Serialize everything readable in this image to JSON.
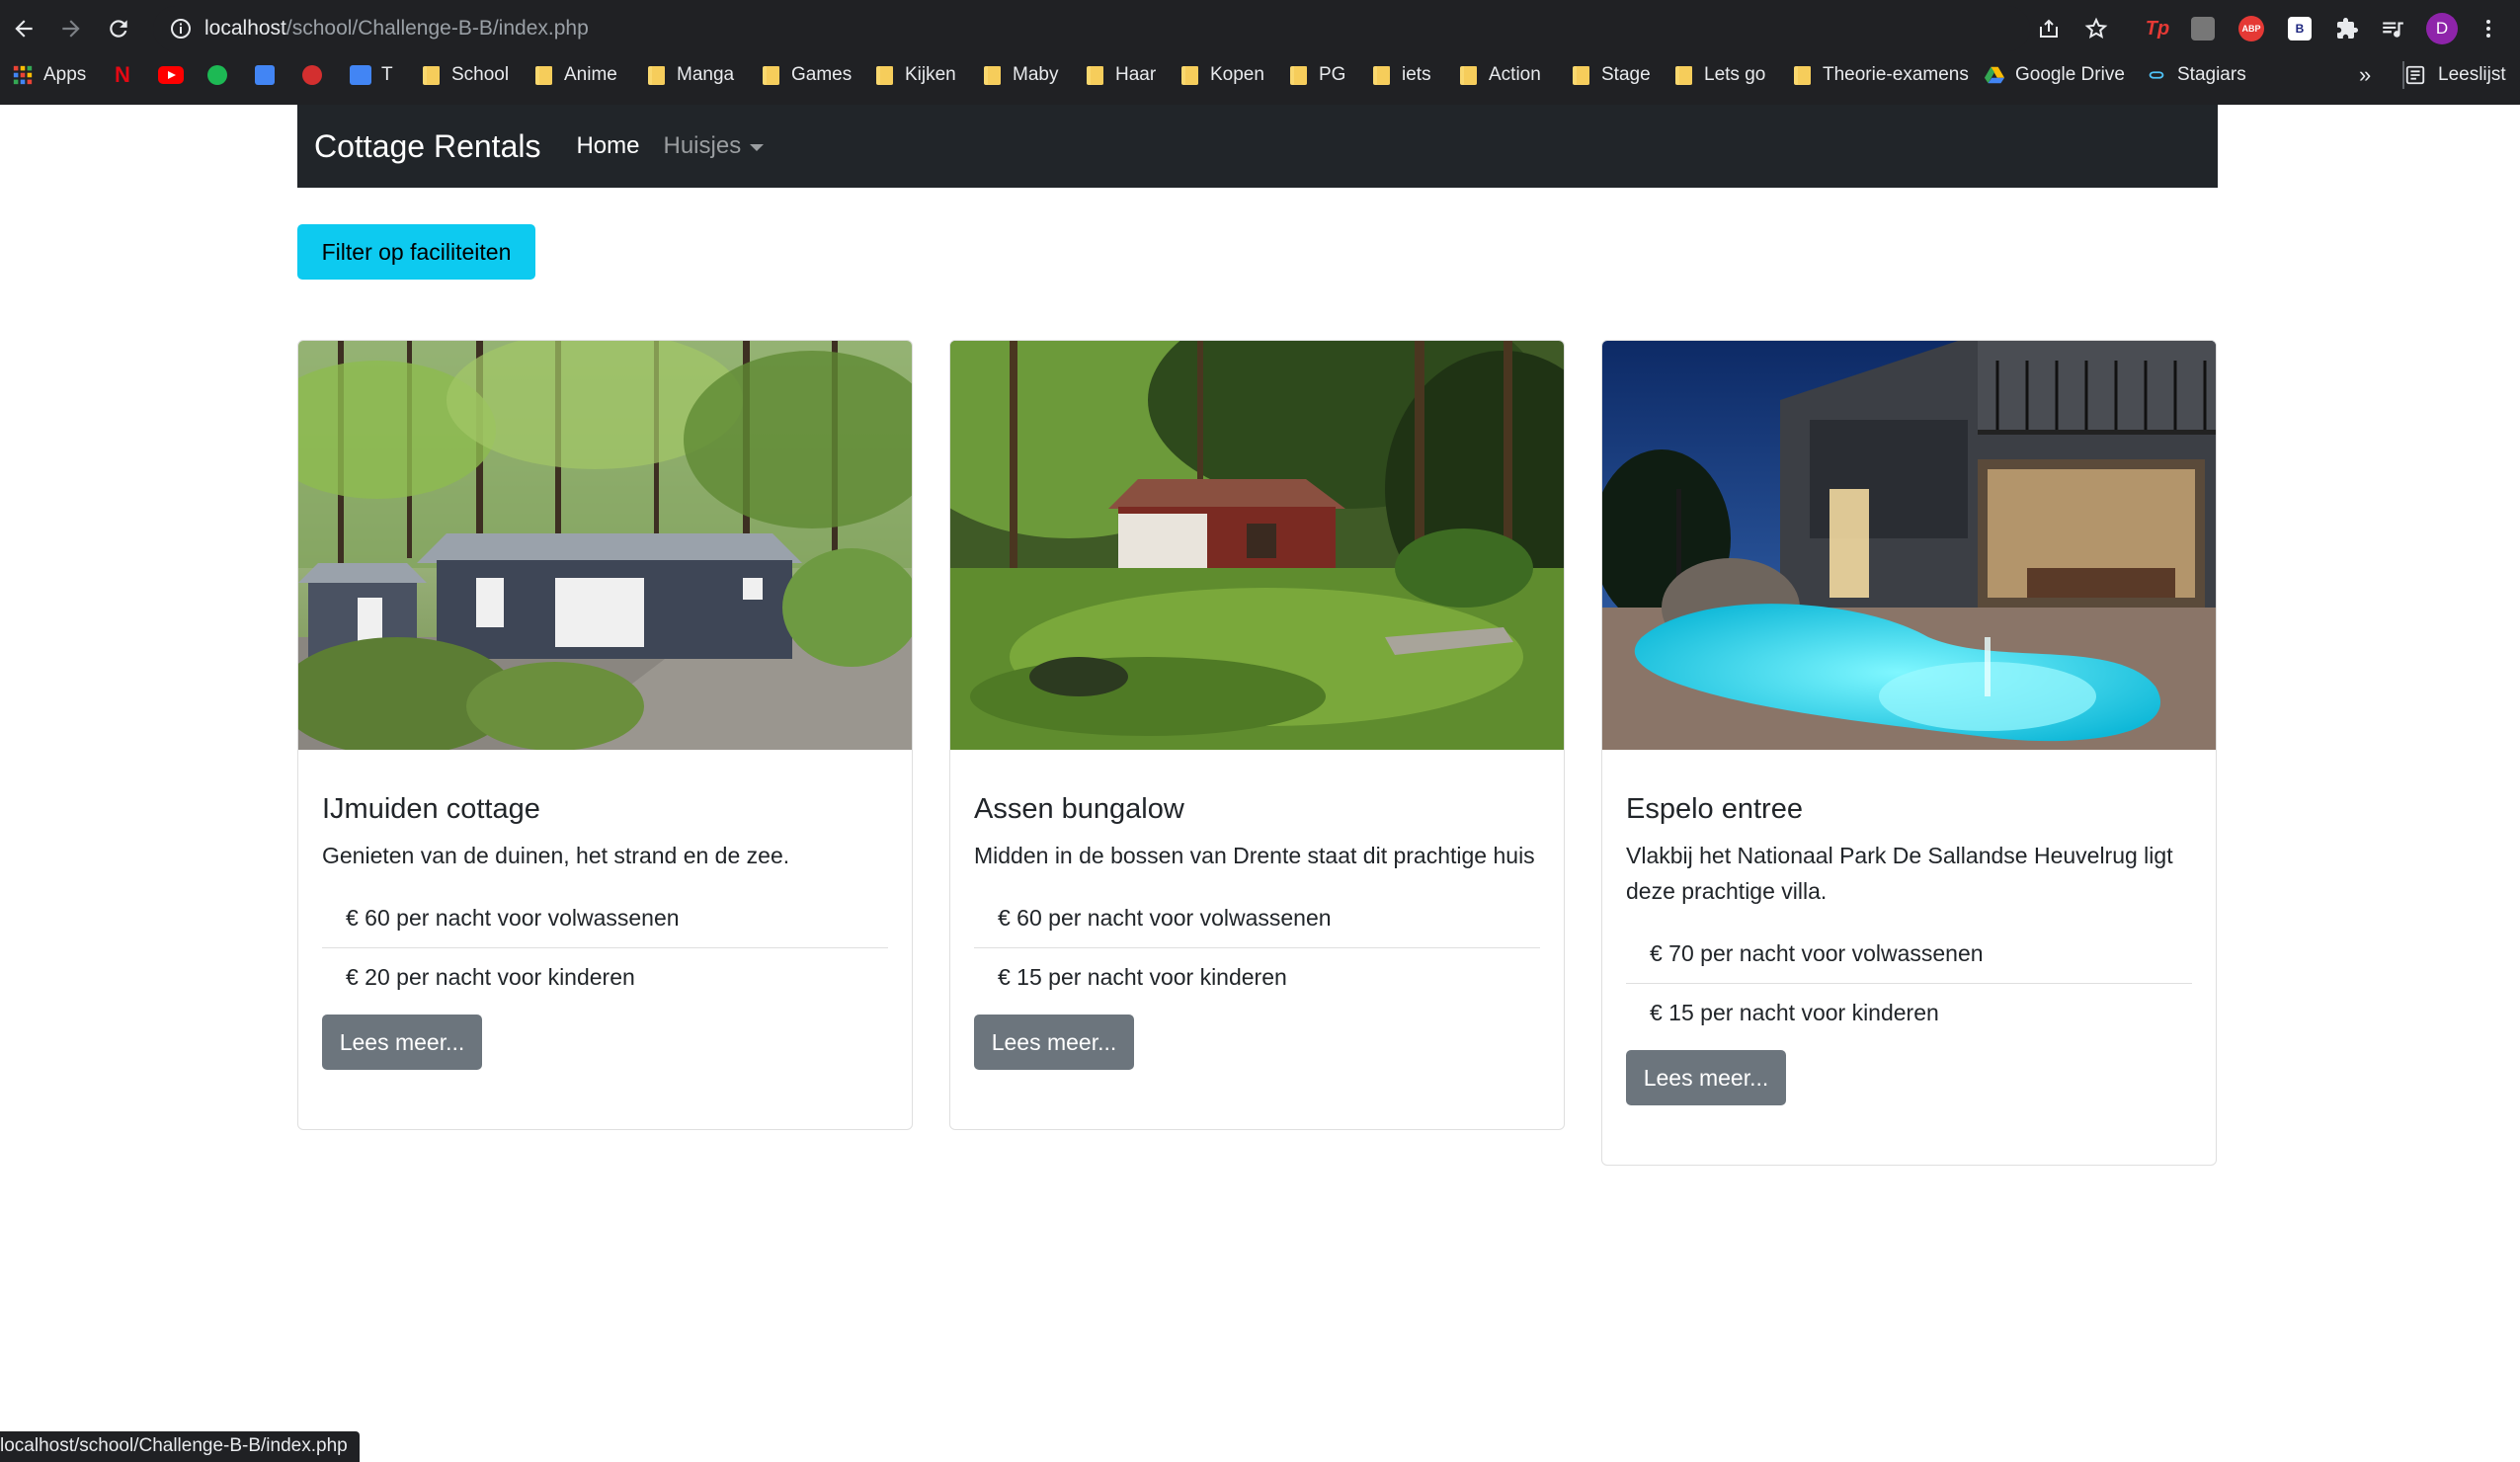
{
  "browser": {
    "url_host": "localhost",
    "url_path": "/school/Challenge-B-B/index.php",
    "bookmarks": {
      "apps": "Apps",
      "t": "T",
      "school": "School",
      "anime": "Anime",
      "manga": "Manga",
      "games": "Games",
      "kijken": "Kijken",
      "maby": "Maby",
      "haar": "Haar",
      "kopen": "Kopen",
      "pg": "PG",
      "iets": "iets",
      "action": "Action",
      "stage": "Stage",
      "lets_go": "Lets go",
      "theorie": "Theorie-examens",
      "google_drive": "Google Drive",
      "stagiars": "Stagiars",
      "overflow": "»",
      "reading_list": "Leeslijst"
    },
    "profile_initial": "D",
    "extensions": {
      "tp": "Tp",
      "abp": "ABP",
      "b": "B"
    },
    "status_text": "localhost/school/Challenge-B-B/index.php"
  },
  "navbar": {
    "brand": "Cottage Rentals",
    "home": "Home",
    "huisjes": "Huisjes"
  },
  "filter_button": "Filter op faciliteiten",
  "cards": [
    {
      "title": "IJmuiden cottage",
      "description": "Genieten van de duinen, het strand en de zee.",
      "price_adults": "€ 60 per nacht voor volwassenen",
      "price_children": "€ 20 per nacht voor kinderen",
      "button": "Lees meer..."
    },
    {
      "title": "Assen bungalow",
      "description": "Midden in de bossen van Drente staat dit prachtige huis",
      "price_adults": "€ 60 per nacht voor volwassenen",
      "price_children": "€ 15 per nacht voor kinderen",
      "button": "Lees meer..."
    },
    {
      "title": "Espelo entree",
      "description": "Vlakbij het Nationaal Park De Sallandse Heuvelrug ligt deze prachtige villa.",
      "price_adults": "€ 70 per nacht voor volwassenen",
      "price_children": "€ 15 per nacht voor kinderen",
      "button": "Lees meer..."
    }
  ],
  "colors": {
    "navbar_bg": "#212529",
    "filter_btn": "#0dcaf0",
    "secondary_btn": "#6c757d",
    "chrome_bg": "#202124"
  }
}
